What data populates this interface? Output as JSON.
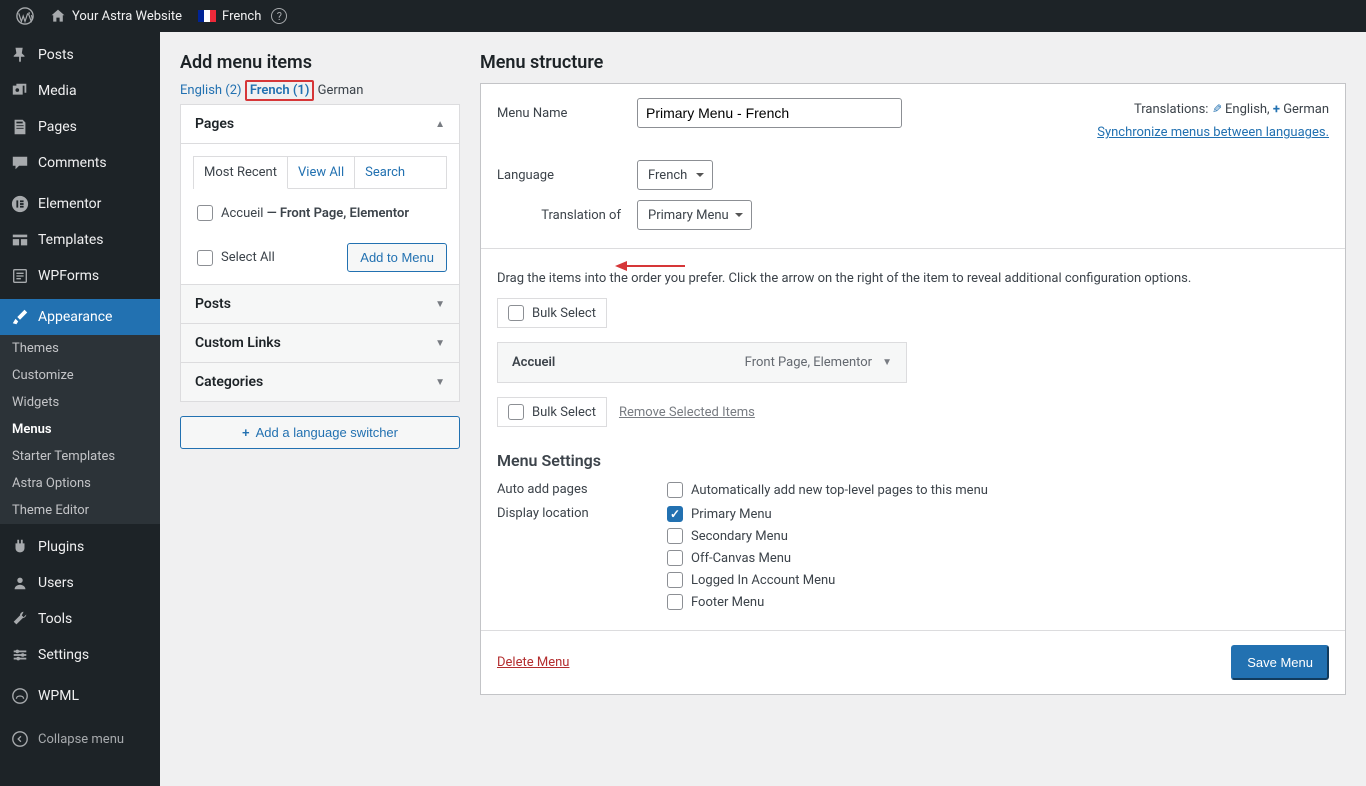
{
  "adminbar": {
    "site_title": "Your Astra Website",
    "language": "French"
  },
  "sidebar": {
    "items": [
      {
        "label": "Posts",
        "icon": "pin"
      },
      {
        "label": "Media",
        "icon": "media"
      },
      {
        "label": "Pages",
        "icon": "pages"
      },
      {
        "label": "Comments",
        "icon": "comment"
      },
      {
        "label": "Elementor",
        "icon": "elementor"
      },
      {
        "label": "Templates",
        "icon": "templates"
      },
      {
        "label": "WPForms",
        "icon": "wpforms"
      },
      {
        "label": "Appearance",
        "icon": "brush"
      },
      {
        "label": "Plugins",
        "icon": "plugin"
      },
      {
        "label": "Users",
        "icon": "users"
      },
      {
        "label": "Tools",
        "icon": "tools"
      },
      {
        "label": "Settings",
        "icon": "settings"
      },
      {
        "label": "WPML",
        "icon": "wpml"
      }
    ],
    "appearance_subs": [
      "Themes",
      "Customize",
      "Widgets",
      "Menus",
      "Starter Templates",
      "Astra Options",
      "Theme Editor"
    ],
    "collapse": "Collapse menu"
  },
  "left_col": {
    "heading": "Add menu items",
    "lang_tabs": {
      "en": "English (2)",
      "fr": "French (1)",
      "de": "German"
    },
    "accordion": {
      "pages": "Pages",
      "posts": "Posts",
      "custom_links": "Custom Links",
      "categories": "Categories"
    },
    "sub_tabs": {
      "recent": "Most Recent",
      "view_all": "View All",
      "search": "Search"
    },
    "page_item": {
      "title": "Accueil",
      "detail": " — Front Page, Elementor"
    },
    "select_all": "Select All",
    "add_to_menu": "Add to Menu",
    "lang_switcher_btn": "Add a language switcher"
  },
  "right_col": {
    "heading": "Menu structure",
    "menu_name_label": "Menu Name",
    "menu_name_value": "Primary Menu - French",
    "translations_label": "Translations:",
    "trans_en": "English,",
    "trans_de": "German",
    "sync_link": "Synchronize menus between languages.",
    "language_label": "Language",
    "language_value": "French",
    "translation_of_label": "Translation of",
    "translation_of_value": "Primary Menu",
    "instructions": "Drag the items into the order you prefer. Click the arrow on the right of the item to reveal additional configuration options.",
    "bulk_select": "Bulk Select",
    "remove_selected": "Remove Selected Items",
    "menu_item": {
      "title": "Accueil",
      "meta": "Front Page, Elementor"
    },
    "settings_heading": "Menu Settings",
    "auto_add_label": "Auto add pages",
    "auto_add_opt": "Automatically add new top-level pages to this menu",
    "display_location_label": "Display location",
    "locations": [
      "Primary Menu",
      "Secondary Menu",
      "Off-Canvas Menu",
      "Logged In Account Menu",
      "Footer Menu"
    ],
    "delete_menu": "Delete Menu",
    "save_menu": "Save Menu"
  }
}
